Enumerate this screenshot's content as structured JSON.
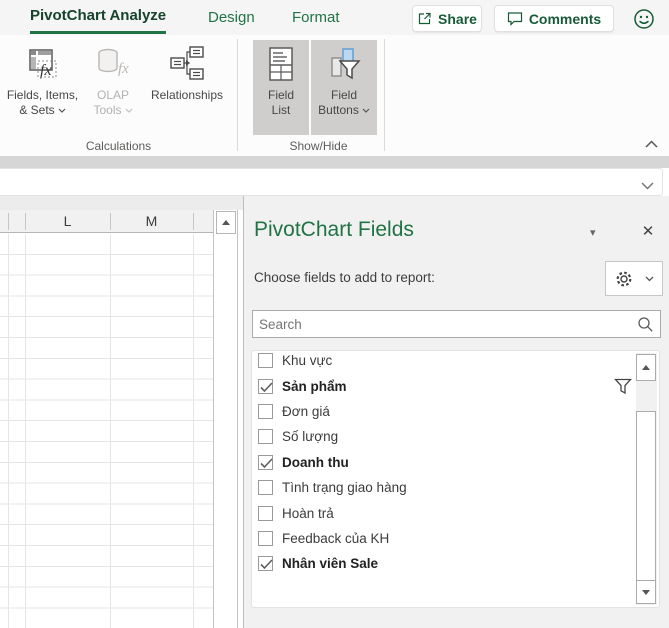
{
  "tab_bar": {
    "tabs": [
      {
        "label": "PivotChart Analyze",
        "active": true
      },
      {
        "label": "Design",
        "active": false
      },
      {
        "label": "Format",
        "active": false
      }
    ],
    "share_label": "Share",
    "comments_label": "Comments"
  },
  "ribbon": {
    "fields_items_sets_line1": "Fields, Items,",
    "fields_items_sets_line2": "& Sets",
    "olap_line1": "OLAP",
    "olap_line2": "Tools",
    "relationships_label": "Relationships",
    "field_list_line1": "Field",
    "field_list_line2": "List",
    "field_buttons_line1": "Field",
    "field_buttons_line2": "Buttons",
    "group_calculations": "Calculations",
    "group_showhide": "Show/Hide",
    "field_list_pressed": true,
    "field_buttons_pressed": true,
    "olap_disabled": true
  },
  "sheet": {
    "columns": [
      "L",
      "M"
    ]
  },
  "panel": {
    "title": "PivotChart Fields",
    "subtitle": "Choose fields to add to report:",
    "search_placeholder": "Search",
    "close_glyph": "✕",
    "caret_glyph": "▾",
    "fields": [
      {
        "label": "Khu vực",
        "checked": false,
        "bold": false,
        "filter": false
      },
      {
        "label": "Sản phẩm",
        "checked": true,
        "bold": true,
        "filter": true
      },
      {
        "label": "Đơn giá",
        "checked": false,
        "bold": false,
        "filter": false
      },
      {
        "label": "Số lượng",
        "checked": false,
        "bold": false,
        "filter": false
      },
      {
        "label": "Doanh thu",
        "checked": true,
        "bold": true,
        "filter": false
      },
      {
        "label": "Tình trạng giao hàng",
        "checked": false,
        "bold": false,
        "filter": false
      },
      {
        "label": "Hoàn trả",
        "checked": false,
        "bold": false,
        "filter": false
      },
      {
        "label": "Feedback của KH",
        "checked": false,
        "bold": false,
        "filter": false
      },
      {
        "label": "Nhân viên Sale",
        "checked": true,
        "bold": true,
        "filter": false
      }
    ]
  },
  "icons": {
    "share": "box-with-outgoing-arrow",
    "comments": "speech-bubble",
    "feedback": "smiley-face",
    "fields_items_sets": "table-with-fx",
    "olap_tools": "cylinder-with-fx",
    "relationships": "linked-boxes",
    "field_list": "list-table",
    "field_buttons": "bar-chart-with-funnel",
    "collapse_ribbon": "chevron-up",
    "expand_formula_bar": "chevron-down",
    "pane_options": "gear",
    "search": "magnifier",
    "field_filter": "funnel",
    "checkbox_check": "checkmark"
  },
  "colors": {
    "accent_green": "#217346",
    "dark_green": "#185c37",
    "pressed_gray": "#d0cecd",
    "panel_bg": "#f0f1f0",
    "gridline": "#e5e5e5"
  }
}
